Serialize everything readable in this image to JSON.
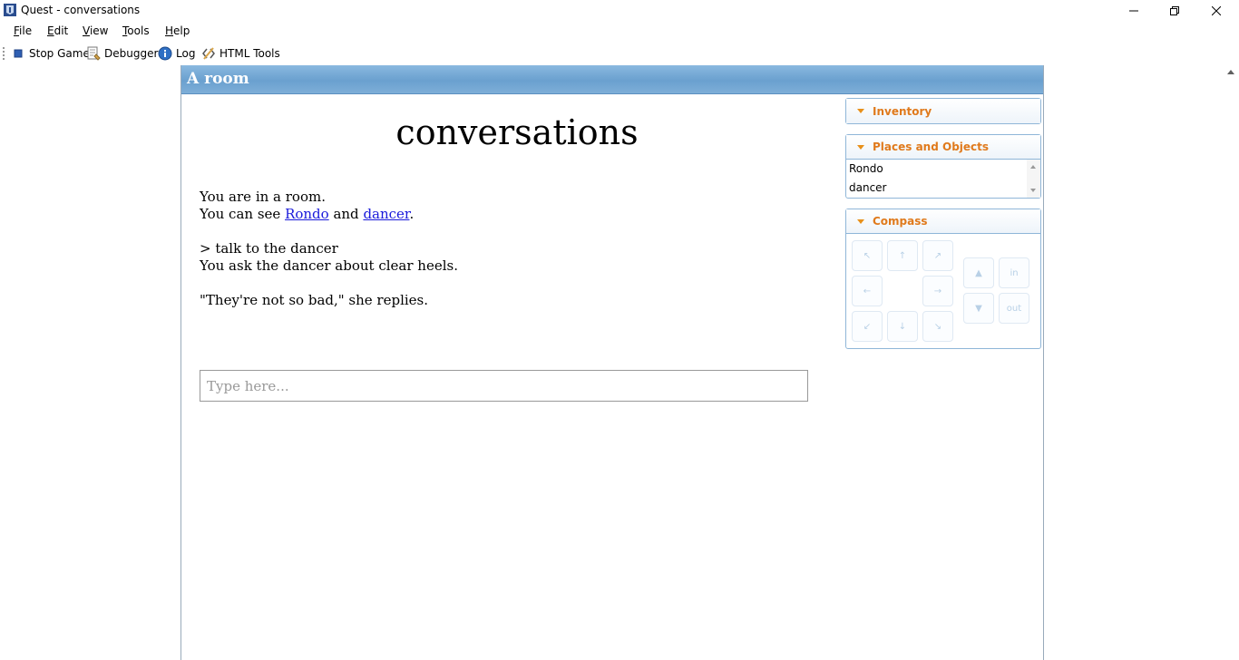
{
  "window": {
    "title": "Quest - conversations"
  },
  "menu": [
    {
      "accel": "F",
      "rest": "ile"
    },
    {
      "accel": "E",
      "rest": "dit"
    },
    {
      "accel": "V",
      "rest": "iew"
    },
    {
      "accel": "T",
      "rest": "ools"
    },
    {
      "accel": "H",
      "rest": "elp"
    }
  ],
  "toolbar": {
    "stop_game": "Stop Game",
    "debugger": "Debugger",
    "log": "Log",
    "html_tools": "HTML Tools"
  },
  "room": {
    "header": "A room"
  },
  "output": {
    "game_title": "conversations",
    "line1": "You are in a room.",
    "see_prefix": "You can see ",
    "link1": "Rondo",
    "and": " and ",
    "link2": "dancer",
    "period": ".",
    "command": "> talk to the dancer",
    "response": "You ask the dancer about clear heels.",
    "reply": "\"They're not so bad,\" she replies."
  },
  "input": {
    "placeholder": "Type here..."
  },
  "panes": {
    "inventory": "Inventory",
    "places": "Places and Objects",
    "places_items": [
      "Rondo",
      "dancer"
    ],
    "compass": "Compass"
  },
  "compass": {
    "nw": "↖",
    "n": "↑",
    "ne": "↗",
    "w": "←",
    "e": "→",
    "sw": "↙",
    "s": "↓",
    "se": "↘",
    "up": "▲",
    "down": "▼",
    "in": "in",
    "out": "out"
  },
  "colors": {
    "accent_orange": "#e07a1c",
    "header_blue": "#6aa0cf",
    "link_blue": "#1a1adb"
  }
}
